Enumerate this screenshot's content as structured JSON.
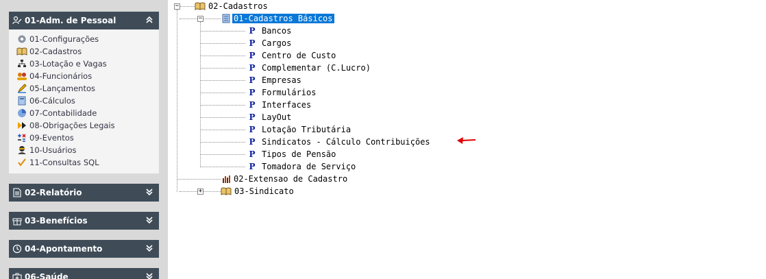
{
  "sidebar": {
    "panels": [
      {
        "title": "01-Adm. de Pessoal",
        "icon": "person-edit-icon",
        "expanded": true
      },
      {
        "title": "02-Relatório",
        "icon": "document-icon",
        "expanded": false
      },
      {
        "title": "03-Benefícios",
        "icon": "gift-icon",
        "expanded": false
      },
      {
        "title": "04-Apontamento",
        "icon": "clock-icon",
        "expanded": false
      },
      {
        "title": "06-Saúde",
        "icon": "medical-kit-icon",
        "expanded": false
      }
    ],
    "items": [
      {
        "label": "01-Configurações",
        "icon": "gear-icon"
      },
      {
        "label": "02-Cadastros",
        "icon": "open-book-icon"
      },
      {
        "label": "03-Lotação e Vagas",
        "icon": "org-chart-icon"
      },
      {
        "label": "04-Funcionários",
        "icon": "people-icon"
      },
      {
        "label": "05-Lançamentos",
        "icon": "pencil-icon"
      },
      {
        "label": "06-Cálculos",
        "icon": "calculator-icon"
      },
      {
        "label": "07-Contabilidade",
        "icon": "pie-chart-icon"
      },
      {
        "label": "08-Obrigações Legais",
        "icon": "fast-forward-icon"
      },
      {
        "label": "09-Eventos",
        "icon": "math-symbols-icon"
      },
      {
        "label": "10-Usuários",
        "icon": "user-icon"
      },
      {
        "label": "11-Consultas SQL",
        "icon": "checkmark-icon"
      }
    ]
  },
  "tree": {
    "root": {
      "label": "02-Cadastros",
      "icon": "open-book-icon",
      "expander": "−"
    },
    "group1": {
      "label": "01-Cadastros Básicos",
      "icon": "notepad-icon",
      "expander": "−",
      "selected": true
    },
    "children": [
      {
        "label": "Bancos",
        "icon": "program-p-icon"
      },
      {
        "label": "Cargos",
        "icon": "program-p-icon"
      },
      {
        "label": "Centro de Custo",
        "icon": "program-p-icon"
      },
      {
        "label": "Complementar (C.Lucro)",
        "icon": "program-p-icon"
      },
      {
        "label": "Empresas",
        "icon": "program-p-icon"
      },
      {
        "label": "Formulários",
        "icon": "program-p-icon"
      },
      {
        "label": "Interfaces",
        "icon": "program-p-icon"
      },
      {
        "label": "LayOut",
        "icon": "program-p-icon"
      },
      {
        "label": "Lotação Tributária",
        "icon": "program-p-icon"
      },
      {
        "label": "Sindicatos - Cálculo Contribuições",
        "icon": "program-p-icon",
        "annotated": true
      },
      {
        "label": "Tipos de Pensão",
        "icon": "program-p-icon"
      },
      {
        "label": "Tomadora de Serviço",
        "icon": "program-p-icon"
      }
    ],
    "group2": {
      "label": "02-Extensao de Cadastro",
      "icon": "bar-chart-icon"
    },
    "group3": {
      "label": "03-Sindicato",
      "icon": "open-book-icon",
      "expander": "+"
    },
    "p_glyph": "P",
    "annotation_color": "#e00000"
  },
  "colors": {
    "sidebar_bg": "#d9d9d9",
    "panel_header": "#3f4c58",
    "selection": "#0a78d7",
    "program_icon": "#0b1f9e"
  }
}
